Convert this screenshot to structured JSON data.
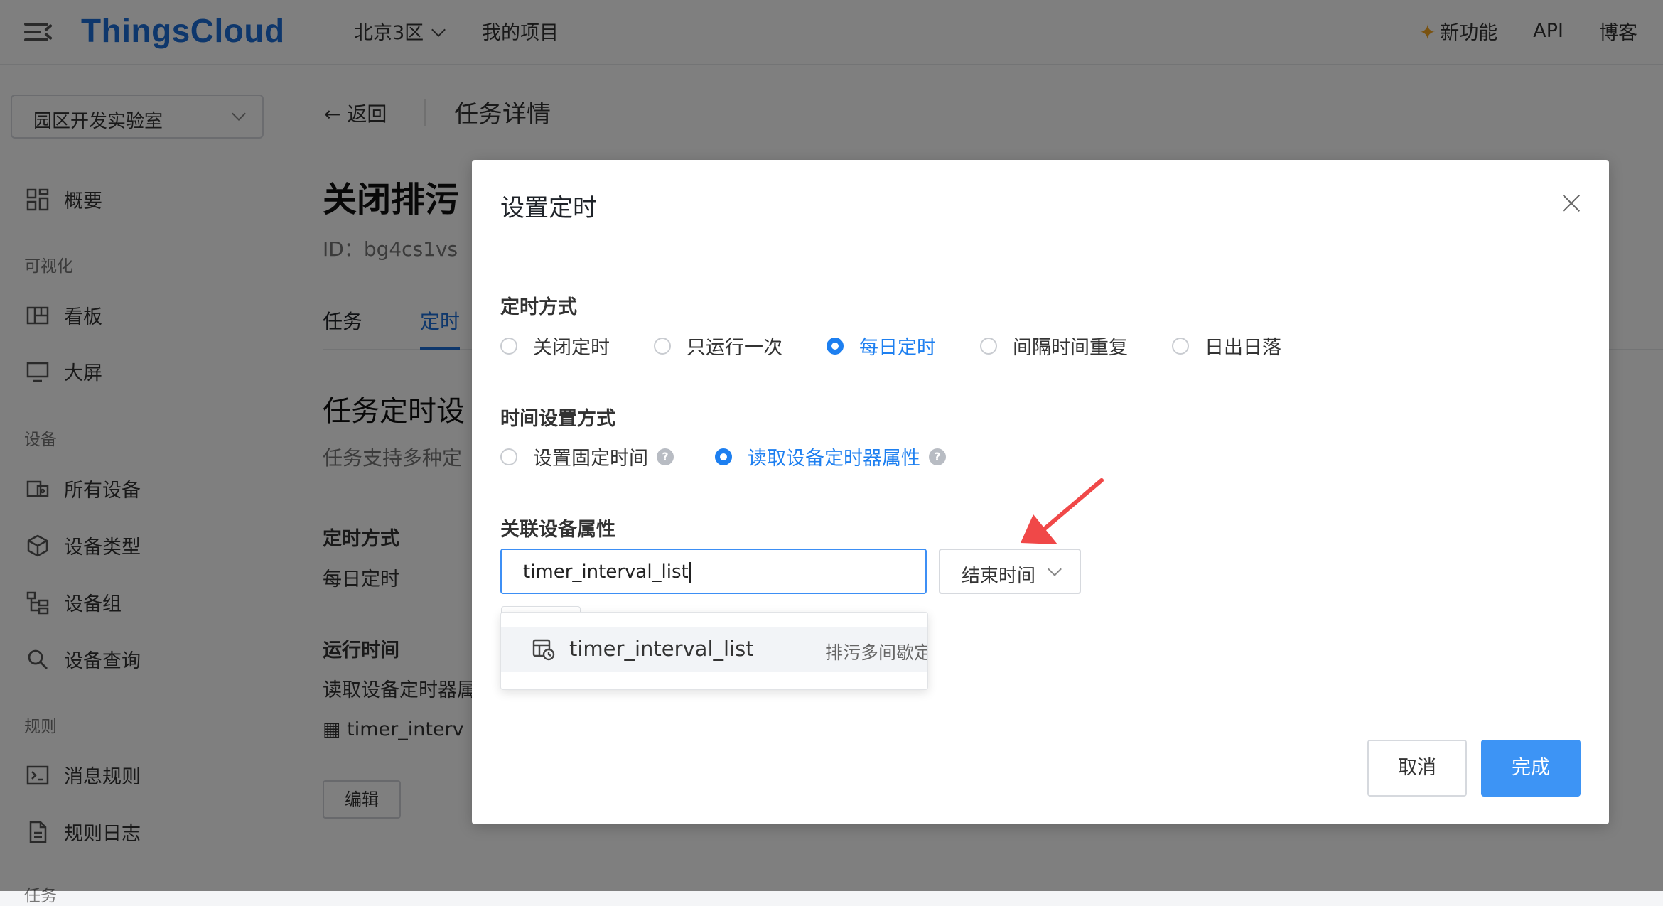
{
  "topbar": {
    "logo": "ThingsCloud",
    "region": "北京3区",
    "projects": "我的项目",
    "new_features": "新功能",
    "api": "API",
    "blog": "博客"
  },
  "sidebar": {
    "org": "园区开发实验室",
    "overview": "概要",
    "group_visual": "可视化",
    "dashboard": "看板",
    "bigscreen": "大屏",
    "group_device": "设备",
    "all_devices": "所有设备",
    "device_types": "设备类型",
    "device_groups": "设备组",
    "device_query": "设备查询",
    "group_rules": "规则",
    "message_rules": "消息规则",
    "rule_logs": "规则日志",
    "group_tasks": "任务"
  },
  "main": {
    "back": "返回",
    "page_title": "任务详情",
    "task_name": "关闭排污",
    "task_id": "ID：bg4cs1vs",
    "tab_task": "任务",
    "tab_timer": "定时",
    "section_title": "任务定时设",
    "section_desc": "任务支持多种定",
    "timer_mode_label": "定时方式",
    "timer_mode_value": "每日定时",
    "run_time_label": "运行时间",
    "run_time_value": "读取设备定时器属",
    "run_time_prop": "timer_interv",
    "edit": "编辑"
  },
  "modal": {
    "title": "设置定时",
    "timer_mode_label": "定时方式",
    "timer_modes": [
      "关闭定时",
      "只运行一次",
      "每日定时",
      "间隔时间重复",
      "日出日落"
    ],
    "timer_mode_selected": "每日定时",
    "time_setting_label": "时间设置方式",
    "time_settings": [
      "设置固定时间",
      "读取设备定时器属性"
    ],
    "time_setting_selected": "读取设备定时器属性",
    "assoc_label": "关联设备属性",
    "prop_input_value": "timer_interval_list",
    "time_select_value": "结束时间",
    "dropdown_option_name": "timer_interval_list",
    "dropdown_option_desc": "排污多间歇定",
    "cancel": "取消",
    "confirm": "完成"
  },
  "colors": {
    "brand": "#1d6fd8",
    "accent": "#3d94f5",
    "arrow": "#f04848"
  }
}
